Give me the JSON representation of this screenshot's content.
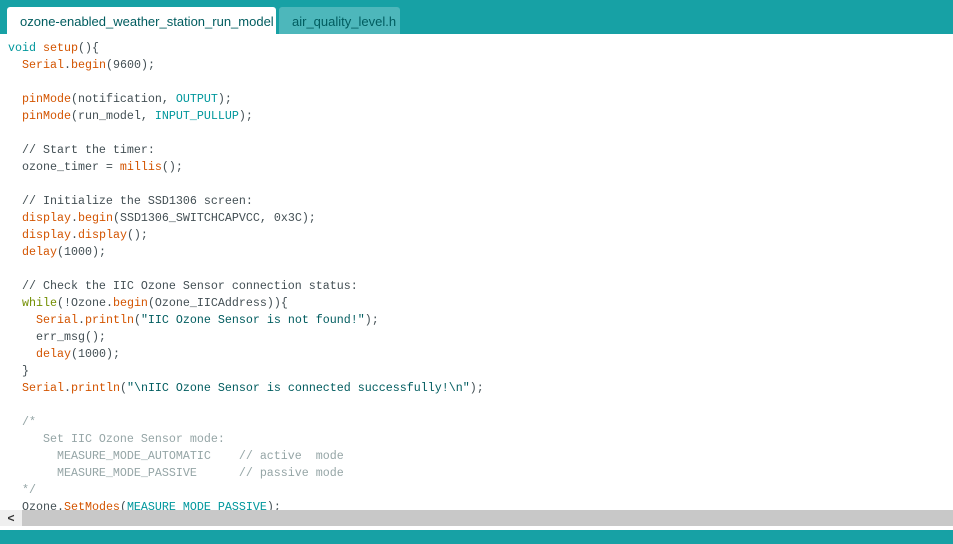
{
  "tabs": [
    {
      "label": "ozone-enabled_weather_station_run_model",
      "active": true
    },
    {
      "label": "air_quality_level.h",
      "active": false
    }
  ],
  "colors": {
    "accent": "#17a1a5",
    "keyword": "#d35400",
    "constant": "#00979c",
    "string": "#005c5f",
    "control": "#728e00",
    "comment": "#95a5a6"
  },
  "icons": {
    "scroll_left": "chevron-left-icon"
  },
  "scroll_left_glyph": "<",
  "code": [
    [
      [
        "void",
        "c"
      ],
      [
        " ",
        "t"
      ],
      [
        "setup",
        "k"
      ],
      [
        "(){",
        "t"
      ]
    ],
    [
      [
        "  ",
        "t"
      ],
      [
        "Serial",
        "k"
      ],
      [
        ".",
        "t"
      ],
      [
        "begin",
        "k"
      ],
      [
        "(9600);",
        "t"
      ]
    ],
    [],
    [
      [
        "  ",
        "t"
      ],
      [
        "pinMode",
        "k"
      ],
      [
        "(notification, ",
        "t"
      ],
      [
        "OUTPUT",
        "c"
      ],
      [
        ");",
        "t"
      ]
    ],
    [
      [
        "  ",
        "t"
      ],
      [
        "pinMode",
        "k"
      ],
      [
        "(run_model, ",
        "t"
      ],
      [
        "INPUT_PULLUP",
        "c"
      ],
      [
        ");",
        "t"
      ]
    ],
    [],
    [
      [
        "  // Start the timer:",
        "cm"
      ]
    ],
    [
      [
        "  ozone_timer = ",
        "t"
      ],
      [
        "millis",
        "k"
      ],
      [
        "();",
        "t"
      ]
    ],
    [],
    [
      [
        "  // Initialize the SSD1306 screen:",
        "cm"
      ]
    ],
    [
      [
        "  ",
        "t"
      ],
      [
        "display",
        "k"
      ],
      [
        ".",
        "t"
      ],
      [
        "begin",
        "k"
      ],
      [
        "(SSD1306_SWITCHCAPVCC, 0x3C);",
        "t"
      ]
    ],
    [
      [
        "  ",
        "t"
      ],
      [
        "display",
        "k"
      ],
      [
        ".",
        "t"
      ],
      [
        "display",
        "k"
      ],
      [
        "();",
        "t"
      ]
    ],
    [
      [
        "  ",
        "t"
      ],
      [
        "delay",
        "k"
      ],
      [
        "(1000);",
        "t"
      ]
    ],
    [],
    [
      [
        "  // Check the IIC Ozone Sensor connection status:",
        "cm"
      ]
    ],
    [
      [
        "  ",
        "t"
      ],
      [
        "while",
        "w"
      ],
      [
        "(!Ozone.",
        "t"
      ],
      [
        "begin",
        "k"
      ],
      [
        "(Ozone_IICAddress)){",
        "t"
      ]
    ],
    [
      [
        "    ",
        "t"
      ],
      [
        "Serial",
        "k"
      ],
      [
        ".",
        "t"
      ],
      [
        "println",
        "k"
      ],
      [
        "(",
        "t"
      ],
      [
        "\"IIC Ozone Sensor is not found!\"",
        "s"
      ],
      [
        ");",
        "t"
      ]
    ],
    [
      [
        "    err_msg();",
        "t"
      ]
    ],
    [
      [
        "    ",
        "t"
      ],
      [
        "delay",
        "k"
      ],
      [
        "(1000);",
        "t"
      ]
    ],
    [
      [
        "  }",
        "t"
      ]
    ],
    [
      [
        "  ",
        "t"
      ],
      [
        "Serial",
        "k"
      ],
      [
        ".",
        "t"
      ],
      [
        "println",
        "k"
      ],
      [
        "(",
        "t"
      ],
      [
        "\"\\nIIC Ozone Sensor is connected successfully!\\n\"",
        "s"
      ],
      [
        ");",
        "t"
      ]
    ],
    [],
    [
      [
        "  /*",
        "bc"
      ]
    ],
    [
      [
        "     Set IIC Ozone Sensor mode:",
        "bc"
      ]
    ],
    [
      [
        "       MEASURE_MODE_AUTOMATIC    // active  mode",
        "bc"
      ]
    ],
    [
      [
        "       MEASURE_MODE_PASSIVE      // passive mode",
        "bc"
      ]
    ],
    [
      [
        "  */",
        "bc"
      ]
    ],
    [
      [
        "  Ozone.",
        "t"
      ],
      [
        "SetModes",
        "k"
      ],
      [
        "(",
        "t"
      ],
      [
        "MEASURE_MODE_PASSIVE",
        "c"
      ],
      [
        ");",
        "t"
      ]
    ]
  ]
}
